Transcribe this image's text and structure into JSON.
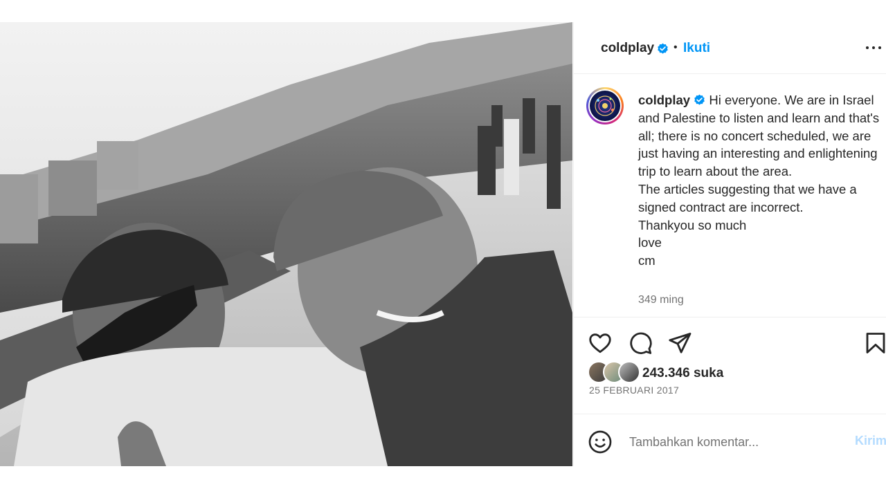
{
  "header": {
    "username": "coldplay",
    "separator": "•",
    "follow_label": "Ikuti",
    "more_icon": "more-options-icon"
  },
  "post": {
    "caption_username": "coldplay",
    "caption_first": "Hi everyone. We are in Israel and Palestine to listen and learn and that's all; there is no concert scheduled, we are just having an interesting and enlightening trip to learn about the area.",
    "caption_lines": [
      "The articles suggesting that we have a signed contract are incorrect.",
      "Thankyou so much",
      "love",
      "cm"
    ],
    "time_ago": "349 ming",
    "likes": "243.346 suka",
    "date": "25 FEBRUARI 2017",
    "photo_alt_icon": "selfie-photo"
  },
  "actions": {
    "like_icon": "heart-icon",
    "comment_icon": "comment-icon",
    "share_icon": "send-icon",
    "save_icon": "bookmark-icon"
  },
  "comment": {
    "placeholder": "Tambahkan komentar...",
    "post_label": "Kirim"
  },
  "colors": {
    "accent": "#0095f6",
    "text": "#262626",
    "muted": "#737373",
    "post_disabled": "#b3dbff"
  }
}
